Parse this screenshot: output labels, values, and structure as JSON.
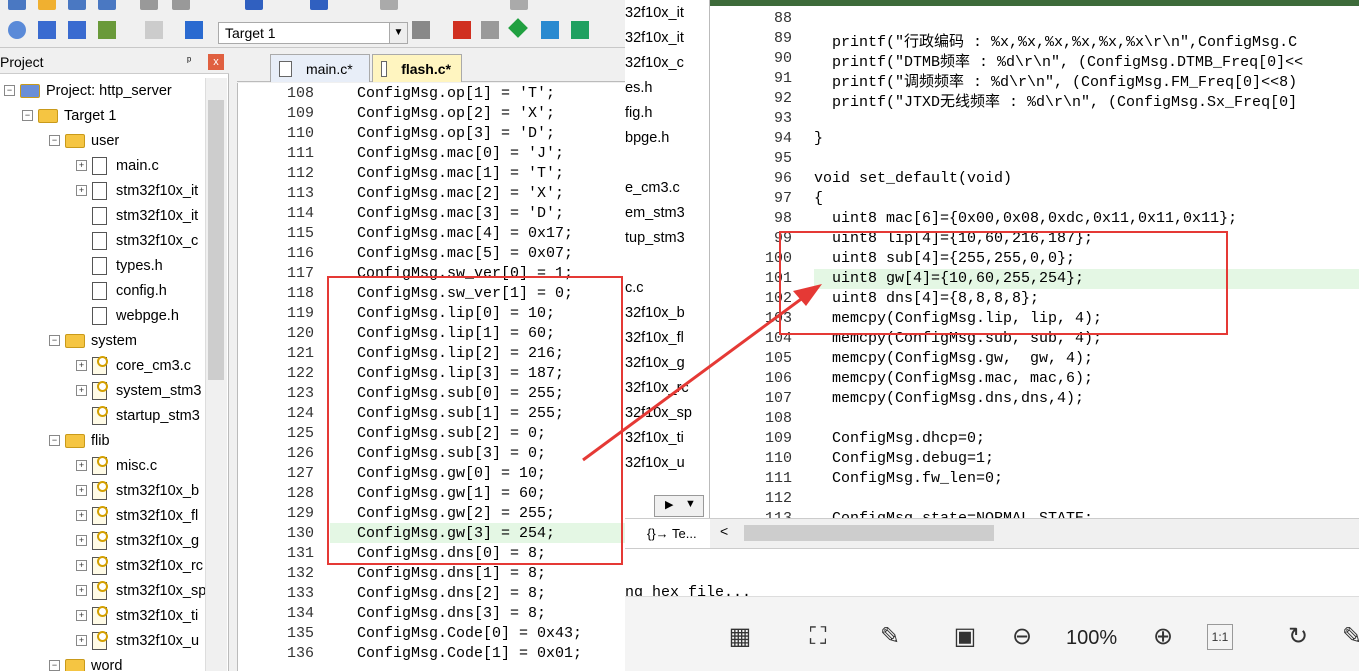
{
  "left_window": {
    "target": "Target 1",
    "project_panel": {
      "title": "Project",
      "pin": "ᵖ",
      "close": "x",
      "items": [
        {
          "label": "Project: http_server",
          "kind": "project",
          "expander": "−"
        },
        {
          "label": "Target 1",
          "kind": "target",
          "expander": "−"
        },
        {
          "label": "user",
          "kind": "folder",
          "expander": "−"
        },
        {
          "label": "main.c",
          "kind": "file",
          "expander": "+"
        },
        {
          "label": "stm32f10x_it",
          "kind": "file",
          "expander": "+"
        },
        {
          "label": "stm32f10x_it",
          "kind": "file",
          "expander": ""
        },
        {
          "label": "stm32f10x_c",
          "kind": "file",
          "expander": ""
        },
        {
          "label": "types.h",
          "kind": "file",
          "expander": ""
        },
        {
          "label": "config.h",
          "kind": "file",
          "expander": ""
        },
        {
          "label": "webpge.h",
          "kind": "file",
          "expander": ""
        },
        {
          "label": "system",
          "kind": "folder",
          "expander": "−"
        },
        {
          "label": "core_cm3.c",
          "kind": "cfile",
          "expander": "+"
        },
        {
          "label": "system_stm3",
          "kind": "cfile",
          "expander": "+"
        },
        {
          "label": "startup_stm3",
          "kind": "cfile",
          "expander": ""
        },
        {
          "label": "flib",
          "kind": "folder",
          "expander": "−"
        },
        {
          "label": "misc.c",
          "kind": "cfile",
          "expander": "+"
        },
        {
          "label": "stm32f10x_b",
          "kind": "cfile",
          "expander": "+"
        },
        {
          "label": "stm32f10x_fl",
          "kind": "cfile",
          "expander": "+"
        },
        {
          "label": "stm32f10x_g",
          "kind": "cfile",
          "expander": "+"
        },
        {
          "label": "stm32f10x_rc",
          "kind": "cfile",
          "expander": "+"
        },
        {
          "label": "stm32f10x_sp",
          "kind": "cfile",
          "expander": "+"
        },
        {
          "label": "stm32f10x_ti",
          "kind": "cfile",
          "expander": "+"
        },
        {
          "label": "stm32f10x_u",
          "kind": "cfile",
          "expander": "+"
        },
        {
          "label": "word",
          "kind": "folder",
          "expander": "−"
        }
      ]
    },
    "tabs": [
      {
        "label": "main.c*",
        "active": false
      },
      {
        "label": "flash.c*",
        "active": true
      }
    ],
    "code_lines": [
      {
        "n": "108",
        "t": "ConfigMsg.op[1] = 'T';"
      },
      {
        "n": "109",
        "t": "ConfigMsg.op[2] = 'X';"
      },
      {
        "n": "110",
        "t": "ConfigMsg.op[3] = 'D';"
      },
      {
        "n": "111",
        "t": "ConfigMsg.mac[0] = 'J';"
      },
      {
        "n": "112",
        "t": "ConfigMsg.mac[1] = 'T';"
      },
      {
        "n": "113",
        "t": "ConfigMsg.mac[2] = 'X';"
      },
      {
        "n": "114",
        "t": "ConfigMsg.mac[3] = 'D';"
      },
      {
        "n": "115",
        "t": "ConfigMsg.mac[4] = 0x17;"
      },
      {
        "n": "116",
        "t": "ConfigMsg.mac[5] = 0x07;"
      },
      {
        "n": "117",
        "t": "ConfigMsg.sw_ver[0] = 1;"
      },
      {
        "n": "118",
        "t": "ConfigMsg.sw_ver[1] = 0;"
      },
      {
        "n": "119",
        "t": "ConfigMsg.lip[0] = 10;"
      },
      {
        "n": "120",
        "t": "ConfigMsg.lip[1] = 60;"
      },
      {
        "n": "121",
        "t": "ConfigMsg.lip[2] = 216;"
      },
      {
        "n": "122",
        "t": "ConfigMsg.lip[3] = 187;"
      },
      {
        "n": "123",
        "t": "ConfigMsg.sub[0] = 255;"
      },
      {
        "n": "124",
        "t": "ConfigMsg.sub[1] = 255;"
      },
      {
        "n": "125",
        "t": "ConfigMsg.sub[2] = 0;"
      },
      {
        "n": "126",
        "t": "ConfigMsg.sub[3] = 0;"
      },
      {
        "n": "127",
        "t": "ConfigMsg.gw[0] = 10;"
      },
      {
        "n": "128",
        "t": "ConfigMsg.gw[1] = 60;"
      },
      {
        "n": "129",
        "t": "ConfigMsg.gw[2] = 255;"
      },
      {
        "n": "130",
        "t": "ConfigMsg.gw[3] = 254;"
      },
      {
        "n": "131",
        "t": "ConfigMsg.dns[0] = 8;"
      },
      {
        "n": "132",
        "t": "ConfigMsg.dns[1] = 8;"
      },
      {
        "n": "133",
        "t": "ConfigMsg.dns[2] = 8;"
      },
      {
        "n": "134",
        "t": "ConfigMsg.dns[3] = 8;"
      },
      {
        "n": "135",
        "t": "ConfigMsg.Code[0] = 0x43;"
      },
      {
        "n": "136",
        "t": "ConfigMsg.Code[1] = 0x01;"
      }
    ]
  },
  "middle_strip": {
    "rows": [
      "32f10x_it",
      "32f10x_it",
      "32f10x_c",
      "es.h",
      "fig.h",
      "bpge.h",
      "",
      "e_cm3.c",
      "em_stm3",
      "tup_stm3",
      "",
      "c.c",
      "32f10x_b",
      "32f10x_fl",
      "32f10x_g",
      "32f10x_rc",
      "32f10x_sp",
      "32f10x_ti",
      "32f10x_u"
    ],
    "bottom_tab": "{}→ Te..."
  },
  "right_window": {
    "code_lines": [
      {
        "n": "88",
        "t": ""
      },
      {
        "n": "89",
        "t": "  printf(\"行政编码 : %x,%x,%x,%x,%x,%x\\r\\n\",ConfigMsg.C"
      },
      {
        "n": "90",
        "t": "  printf(\"DTMB频率 : %d\\r\\n\", (ConfigMsg.DTMB_Freq[0]<<"
      },
      {
        "n": "91",
        "t": "  printf(\"调频频率 : %d\\r\\n\", (ConfigMsg.FM_Freq[0]<<8)"
      },
      {
        "n": "92",
        "t": "  printf(\"JTXD无线频率 : %d\\r\\n\", (ConfigMsg.Sx_Freq[0]"
      },
      {
        "n": "93",
        "t": ""
      },
      {
        "n": "94",
        "t": "}"
      },
      {
        "n": "95",
        "t": ""
      },
      {
        "n": "96",
        "t": "void set_default(void)"
      },
      {
        "n": "97",
        "t": "{"
      },
      {
        "n": "98",
        "t": "  uint8 mac[6]={0x00,0x08,0xdc,0x11,0x11,0x11};"
      },
      {
        "n": "99",
        "t": "  uint8 lip[4]={10,60,216,187};"
      },
      {
        "n": "100",
        "t": "  uint8 sub[4]={255,255,0,0};"
      },
      {
        "n": "101",
        "t": "  uint8 gw[4]={10,60,255,254};"
      },
      {
        "n": "102",
        "t": "  uint8 dns[4]={8,8,8,8};"
      },
      {
        "n": "103",
        "t": "  memcpy(ConfigMsg.lip, lip, 4);"
      },
      {
        "n": "104",
        "t": "  memcpy(ConfigMsg.sub, sub, 4);"
      },
      {
        "n": "105",
        "t": "  memcpy(ConfigMsg.gw,  gw, 4);"
      },
      {
        "n": "106",
        "t": "  memcpy(ConfigMsg.mac, mac,6);"
      },
      {
        "n": "107",
        "t": "  memcpy(ConfigMsg.dns,dns,4);"
      },
      {
        "n": "108",
        "t": ""
      },
      {
        "n": "109",
        "t": "  ConfigMsg.dhcp=0;"
      },
      {
        "n": "110",
        "t": "  ConfigMsg.debug=1;"
      },
      {
        "n": "111",
        "t": "  ConfigMsg.fw_len=0;"
      },
      {
        "n": "112",
        "t": ""
      },
      {
        "n": "113",
        "t": "  ConfigMsg.state=NORMAL_STATE;"
      }
    ]
  },
  "output": {
    "text": "ng hex file..."
  },
  "viewer": {
    "zoom": "100%",
    "ratio_label": "1:1"
  },
  "colors": {
    "annotation": "#e53935",
    "highlight": "#e4f7e4",
    "title_green": "#3d6b3a"
  }
}
